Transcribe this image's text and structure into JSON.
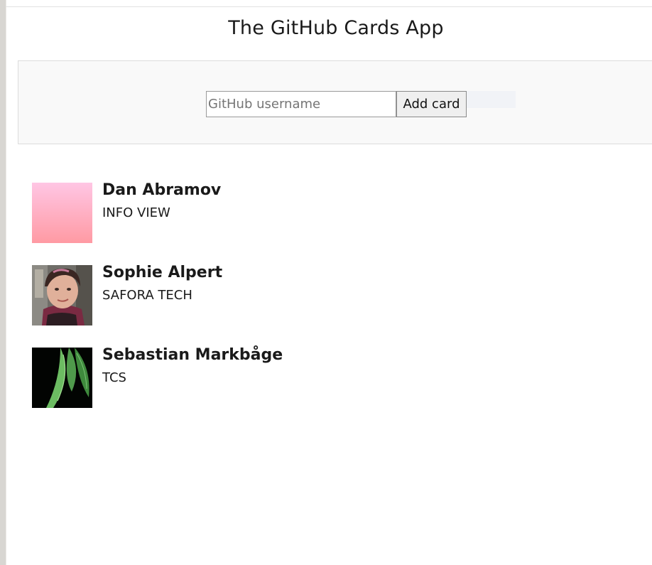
{
  "header": {
    "title": "The GitHub Cards App"
  },
  "form": {
    "username_placeholder": "GitHub username",
    "username_value": "",
    "add_button_label": "Add card"
  },
  "cards": [
    {
      "name": "Dan Abramov",
      "company": "INFO VIEW",
      "avatar": "pink-gradient-avatar"
    },
    {
      "name": "Sophie Alpert",
      "company": "SAFORA TECH",
      "avatar": "person-photo-avatar"
    },
    {
      "name": "Sebastian Markbåge",
      "company": "TCS",
      "avatar": "green-leaves-avatar"
    }
  ],
  "colors": {
    "panel_background": "#f9f9f9",
    "panel_border": "#dcdcdc",
    "text": "#1a1a1a",
    "button_background": "#efefef"
  }
}
